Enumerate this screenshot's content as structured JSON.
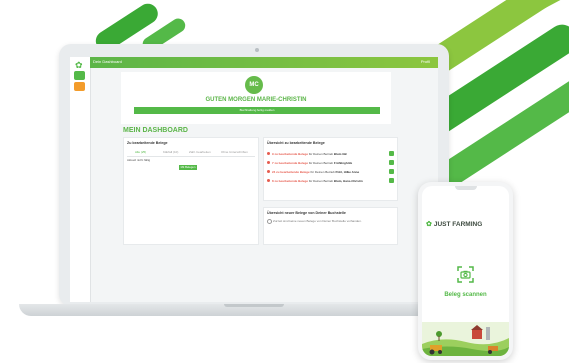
{
  "colors": {
    "brand_green": "#54b948",
    "light_green": "#8cc63f",
    "alert_red": "#e65c4f"
  },
  "app": {
    "logo_icon": "leaf-logo-icon",
    "topbar": {
      "title": "Dein Dashboard",
      "right": "Profil"
    },
    "greeting": {
      "initials": "MC",
      "text": "GUTEN MORGEN MARIE-CHRISTIN",
      "button": "Buchhaltung fertig melden"
    },
    "dashboard_title": "MEIN DASHBOARD",
    "left_panel": {
      "title": "Zu bearbeitende Belege",
      "tabs": [
        "Alle (25)",
        "Klärfall (10)",
        "Zahl. bearbeiten",
        "Ohne Unterschriften"
      ],
      "row": "Aktuell nicht fällig",
      "button": "Mit Belegen"
    },
    "overview": {
      "title": "Übersicht zu bearbeitende Belege",
      "items": [
        {
          "count": "9 zu bearbeitende Belege",
          "text": " für Deinen Betrieb ",
          "farm": "Blum GB"
        },
        {
          "count": "7 zu bearbeitende Belege",
          "text": " für Deinen Betrieb ",
          "farm": "Frühlinghöfe"
        },
        {
          "count": "24 zu bearbeitende Belege",
          "text": " für Deinen Betrieb ",
          "farm": "Pohl, Hilke Anne"
        },
        {
          "count": "8 zu bearbeitende Belege",
          "text": " für Deinen Betrieb ",
          "farm": "Blum, Hans-Christin"
        }
      ]
    },
    "new_docs": {
      "title": "Übersicht neuer Belege von Deiner Buchstelle",
      "empty": "Zurzeit sind keine neuen Belege von Deiner Buchstelle vorhanden."
    }
  },
  "phone": {
    "brand": "JUST FARMING",
    "brand_icon": "leaf-logo-icon",
    "scan_icon": "camera-scan-icon",
    "scan_label": "Beleg scannen"
  }
}
